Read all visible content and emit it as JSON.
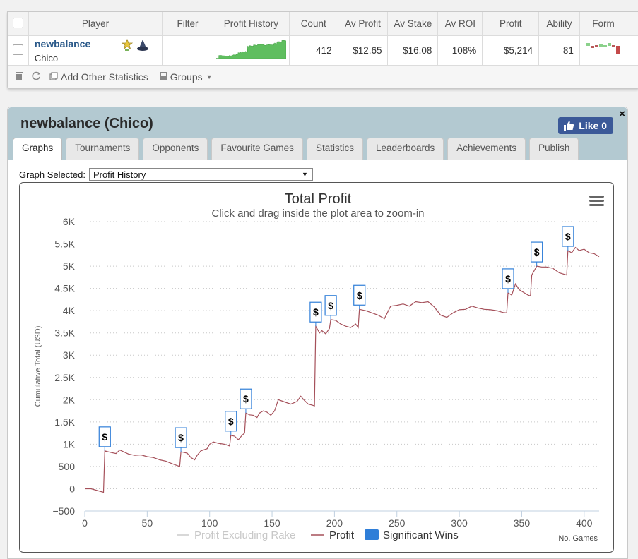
{
  "table": {
    "headers": [
      "Player",
      "Filter",
      "Profit History",
      "Count",
      "Av Profit",
      "Av Stake",
      "Av ROI",
      "Profit",
      "Ability",
      "Form"
    ],
    "row": {
      "player_name": "newbalance",
      "player_site": "Chico",
      "count": "412",
      "av_profit": "$12.65",
      "av_stake": "$16.08",
      "av_roi": "108%",
      "profit": "$5,214",
      "ability": "81"
    }
  },
  "toolbar": {
    "delete_icon": "trash-icon",
    "refresh_icon": "refresh-icon",
    "add_stats_label": "Add Other Statistics",
    "groups_label": "Groups"
  },
  "panel": {
    "title": "newbalance (Chico)",
    "like_label": "Like 0",
    "close_label": "×",
    "tabs": [
      "Graphs",
      "Tournaments",
      "Opponents",
      "Favourite Games",
      "Statistics",
      "Leaderboards",
      "Achievements",
      "Publish"
    ],
    "graph_selected_label": "Graph Selected:",
    "graph_selected_value": "Profit History"
  },
  "chart_data": {
    "type": "line",
    "title": "Total Profit",
    "subtitle": "Click and drag inside the plot area to zoom-in",
    "ylabel": "Cumulative Total (USD)",
    "xlabel": "No. Games",
    "xlim": [
      0,
      412
    ],
    "ylim": [
      -500,
      6000
    ],
    "x_ticks": [
      0,
      50,
      100,
      150,
      200,
      250,
      300,
      350,
      400
    ],
    "y_ticks": [
      -500,
      0,
      500,
      1000,
      1500,
      2000,
      2500,
      3000,
      3500,
      4000,
      4500,
      5000,
      5500,
      6000
    ],
    "y_tick_labels": [
      "−500",
      "0",
      "500",
      "1K",
      "1.5K",
      "2K",
      "2.5K",
      "3K",
      "3.5K",
      "4K",
      "4.5K",
      "5K",
      "5.5K",
      "6K"
    ],
    "legend": [
      "Profit Excluding Rake",
      "Profit",
      "Significant Wins"
    ],
    "flag_label": "$",
    "series": [
      {
        "name": "Profit",
        "color": "#a5505a",
        "points": [
          [
            0,
            0
          ],
          [
            5,
            0
          ],
          [
            10,
            -40
          ],
          [
            15,
            -80
          ],
          [
            16,
            850
          ],
          [
            20,
            820
          ],
          [
            25,
            790
          ],
          [
            28,
            870
          ],
          [
            35,
            780
          ],
          [
            40,
            750
          ],
          [
            45,
            760
          ],
          [
            50,
            720
          ],
          [
            55,
            700
          ],
          [
            60,
            650
          ],
          [
            65,
            620
          ],
          [
            70,
            560
          ],
          [
            76,
            500
          ],
          [
            77,
            830
          ],
          [
            82,
            800
          ],
          [
            85,
            700
          ],
          [
            88,
            650
          ],
          [
            90,
            750
          ],
          [
            93,
            850
          ],
          [
            96,
            880
          ],
          [
            98,
            900
          ],
          [
            100,
            1000
          ],
          [
            103,
            1050
          ],
          [
            107,
            1020
          ],
          [
            112,
            1000
          ],
          [
            116,
            960
          ],
          [
            117,
            1200
          ],
          [
            120,
            1180
          ],
          [
            123,
            1100
          ],
          [
            126,
            1200
          ],
          [
            128,
            1250
          ],
          [
            129,
            1700
          ],
          [
            132,
            1660
          ],
          [
            135,
            1650
          ],
          [
            138,
            1600
          ],
          [
            140,
            1700
          ],
          [
            143,
            1750
          ],
          [
            146,
            1720
          ],
          [
            149,
            1650
          ],
          [
            152,
            1750
          ],
          [
            155,
            2000
          ],
          [
            160,
            1950
          ],
          [
            165,
            1900
          ],
          [
            170,
            1960
          ],
          [
            173,
            2080
          ],
          [
            176,
            1980
          ],
          [
            179,
            1900
          ],
          [
            182,
            1880
          ],
          [
            184,
            1860
          ],
          [
            185,
            3650
          ],
          [
            188,
            3500
          ],
          [
            190,
            3550
          ],
          [
            193,
            3480
          ],
          [
            196,
            3600
          ],
          [
            197,
            3800
          ],
          [
            201,
            3780
          ],
          [
            205,
            3700
          ],
          [
            209,
            3650
          ],
          [
            213,
            3620
          ],
          [
            217,
            3700
          ],
          [
            219,
            3620
          ],
          [
            220,
            4030
          ],
          [
            225,
            4000
          ],
          [
            230,
            3950
          ],
          [
            235,
            3900
          ],
          [
            240,
            3820
          ],
          [
            245,
            4100
          ],
          [
            250,
            4120
          ],
          [
            255,
            4150
          ],
          [
            260,
            4100
          ],
          [
            265,
            4200
          ],
          [
            270,
            4180
          ],
          [
            275,
            4200
          ],
          [
            280,
            4080
          ],
          [
            285,
            3900
          ],
          [
            290,
            3850
          ],
          [
            295,
            3950
          ],
          [
            300,
            4020
          ],
          [
            305,
            4030
          ],
          [
            310,
            4100
          ],
          [
            315,
            4060
          ],
          [
            320,
            4030
          ],
          [
            325,
            4020
          ],
          [
            330,
            4000
          ],
          [
            335,
            3960
          ],
          [
            338,
            3950
          ],
          [
            339,
            4400
          ],
          [
            342,
            4350
          ],
          [
            345,
            4600
          ],
          [
            348,
            4470
          ],
          [
            352,
            4400
          ],
          [
            355,
            4350
          ],
          [
            357,
            4330
          ],
          [
            358,
            4800
          ],
          [
            362,
            5000
          ],
          [
            366,
            4980
          ],
          [
            370,
            4980
          ],
          [
            375,
            4950
          ],
          [
            380,
            4850
          ],
          [
            386,
            4800
          ],
          [
            387,
            5350
          ],
          [
            390,
            5300
          ],
          [
            393,
            5420
          ],
          [
            396,
            5350
          ],
          [
            400,
            5380
          ],
          [
            404,
            5300
          ],
          [
            408,
            5280
          ],
          [
            412,
            5214
          ]
        ]
      }
    ],
    "significant_wins_x": [
      16,
      77,
      117,
      129,
      185,
      197,
      220,
      339,
      362,
      387
    ]
  }
}
